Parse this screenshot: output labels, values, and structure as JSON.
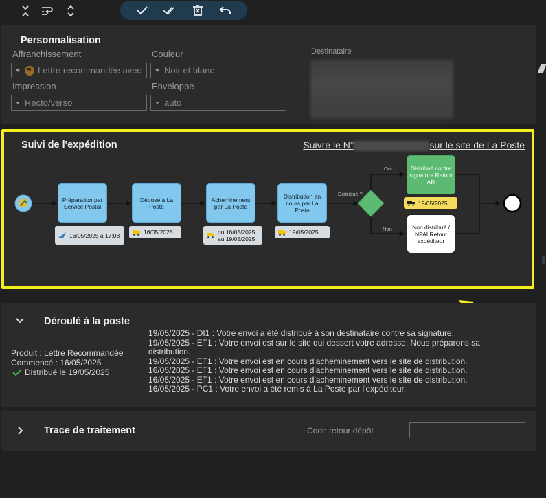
{
  "toolbar": {
    "icons": [
      "collapse-all-icon",
      "wrap-icon",
      "expand-all-icon"
    ],
    "actions": [
      "check-icon",
      "double-check-icon",
      "delete-icon",
      "undo-icon"
    ]
  },
  "perso": {
    "title": "Personnalisation",
    "affranchissement_label": "Affranchissement",
    "affranchissement_value": "Lettre recommandée avec",
    "affranchissement_badge": "RL",
    "couleur_label": "Couleur",
    "couleur_value": "Noir et blanc",
    "impression_label": "Impression",
    "impression_value": "Recto/verso",
    "enveloppe_label": "Enveloppe",
    "enveloppe_value": "auto",
    "destinataire_label": "Destinataire"
  },
  "suivi": {
    "title": "Suivi de l'expédition",
    "link_prefix": "Suivre le N°",
    "link_suffix": "sur le site de La Poste",
    "steps": [
      {
        "label": "Préparation par Service Postal",
        "date": "16/05/2025 à 17:08"
      },
      {
        "label": "Déposé à La Poste",
        "date": "16/05/2025"
      },
      {
        "label": "Acheminement par La Poste",
        "date": "du 16/05/2025 au 19/05/2025"
      },
      {
        "label": "Distribution en cours par La Poste",
        "date": "19/05/2025"
      }
    ],
    "gateway_label": "Distribué ?",
    "branch_yes": "Oui",
    "branch_no": "Non",
    "outcome_ok": {
      "label": "Distribué contre signature Retour AR",
      "date": "19/05/2025"
    },
    "outcome_ko": {
      "label": "Non distribué / NPAI Retour expéditeur"
    },
    "colors": {
      "task": "#82c7ee",
      "success": "#5cba73",
      "gateway": "#5cba73",
      "highlight": "#f4ef1c"
    }
  },
  "deroule": {
    "title": "Déroulé à la poste",
    "produit": "Produit : Lettre Recommandée",
    "commence": "Commencé : 16/05/2025",
    "status": "Distribué le 19/05/2025",
    "events": [
      "19/05/2025 - DI1 : Votre envoi a été distribué à son destinataire contre sa signature.",
      "19/05/2025 - ET1 : Votre envoi est sur le site qui dessert votre adresse. Nous préparons sa distribution.",
      "19/05/2025 - ET1 : Votre envoi est en cours d'acheminement vers le site de distribution.",
      "16/05/2025 - ET1 : Votre envoi est en cours d'acheminement vers le site de distribution.",
      "16/05/2025 - ET1 : Votre envoi est en cours d'acheminement vers le site de distribution.",
      "16/05/2025 - PC1 : Votre envoi a été remis à La Poste par l'expéditeur."
    ]
  },
  "trace": {
    "title": "Trace de traitement",
    "code_label": "Code retour dépôt",
    "code_value": ""
  }
}
